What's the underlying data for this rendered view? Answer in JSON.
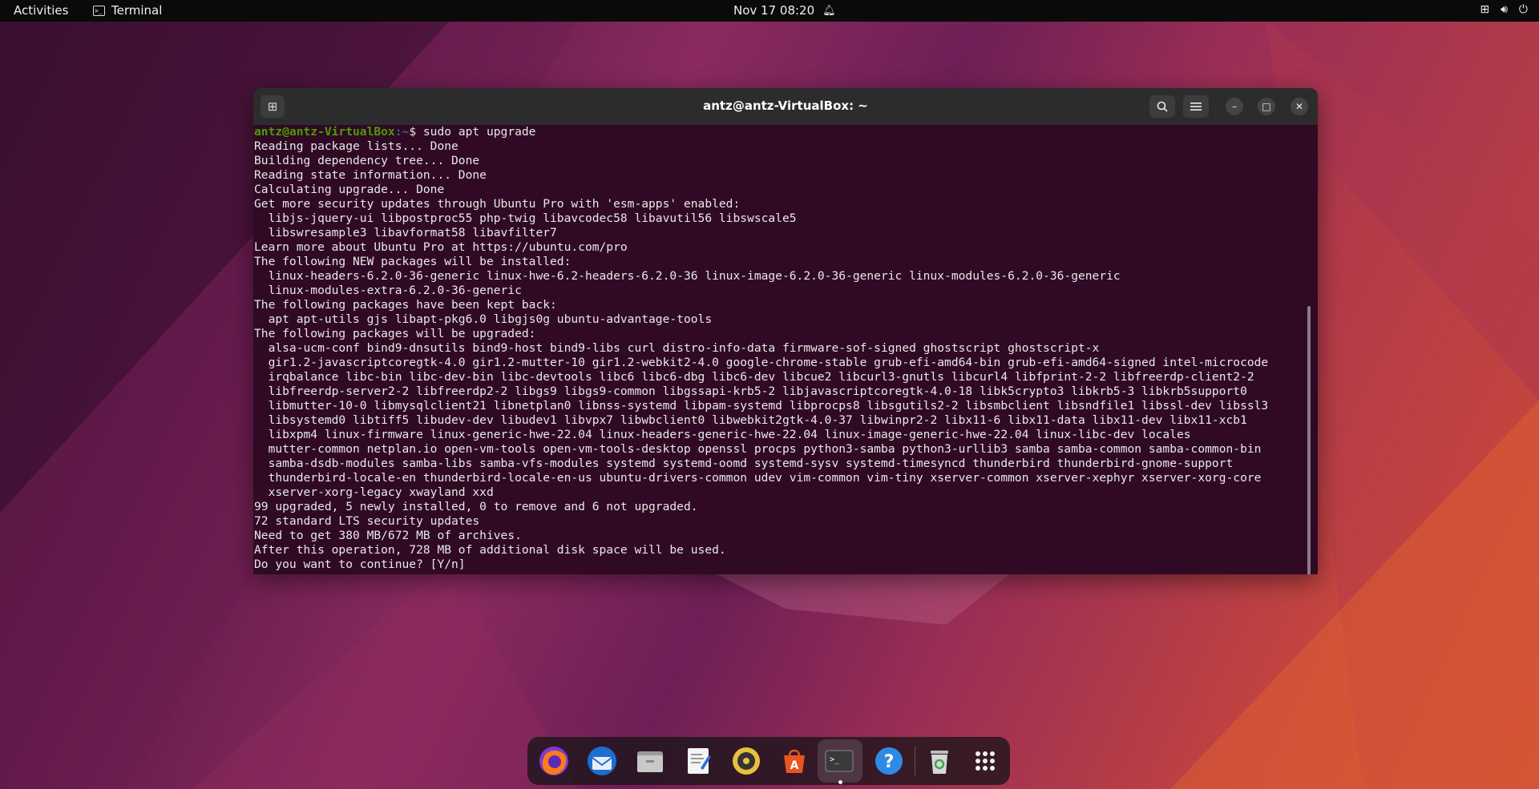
{
  "topbar": {
    "activities": "Activities",
    "app_name": "Terminal",
    "clock": "Nov 17  08:20"
  },
  "window": {
    "title": "antz@antz-VirtualBox: ~"
  },
  "terminal": {
    "prompt_user": "antz@antz-VirtualBox",
    "prompt_path": ":~",
    "prompt_symbol": "$ ",
    "command": "sudo apt upgrade",
    "output": [
      "Reading package lists... Done",
      "Building dependency tree... Done",
      "Reading state information... Done",
      "Calculating upgrade... Done",
      "Get more security updates through Ubuntu Pro with 'esm-apps' enabled:",
      "  libjs-jquery-ui libpostproc55 php-twig libavcodec58 libavutil56 libswscale5",
      "  libswresample3 libavformat58 libavfilter7",
      "Learn more about Ubuntu Pro at https://ubuntu.com/pro",
      "The following NEW packages will be installed:",
      "  linux-headers-6.2.0-36-generic linux-hwe-6.2-headers-6.2.0-36 linux-image-6.2.0-36-generic linux-modules-6.2.0-36-generic",
      "  linux-modules-extra-6.2.0-36-generic",
      "The following packages have been kept back:",
      "  apt apt-utils gjs libapt-pkg6.0 libgjs0g ubuntu-advantage-tools",
      "The following packages will be upgraded:",
      "  alsa-ucm-conf bind9-dnsutils bind9-host bind9-libs curl distro-info-data firmware-sof-signed ghostscript ghostscript-x",
      "  gir1.2-javascriptcoregtk-4.0 gir1.2-mutter-10 gir1.2-webkit2-4.0 google-chrome-stable grub-efi-amd64-bin grub-efi-amd64-signed intel-microcode",
      "  irqbalance libc-bin libc-dev-bin libc-devtools libc6 libc6-dbg libc6-dev libcue2 libcurl3-gnutls libcurl4 libfprint-2-2 libfreerdp-client2-2",
      "  libfreerdp-server2-2 libfreerdp2-2 libgs9 libgs9-common libgssapi-krb5-2 libjavascriptcoregtk-4.0-18 libk5crypto3 libkrb5-3 libkrb5support0",
      "  libmutter-10-0 libmysqlclient21 libnetplan0 libnss-systemd libpam-systemd libprocps8 libsgutils2-2 libsmbclient libsndfile1 libssl-dev libssl3",
      "  libsystemd0 libtiff5 libudev-dev libudev1 libvpx7 libwbclient0 libwebkit2gtk-4.0-37 libwinpr2-2 libx11-6 libx11-data libx11-dev libx11-xcb1",
      "  libxpm4 linux-firmware linux-generic-hwe-22.04 linux-headers-generic-hwe-22.04 linux-image-generic-hwe-22.04 linux-libc-dev locales",
      "  mutter-common netplan.io open-vm-tools open-vm-tools-desktop openssl procps python3-samba python3-urllib3 samba samba-common samba-common-bin",
      "  samba-dsdb-modules samba-libs samba-vfs-modules systemd systemd-oomd systemd-sysv systemd-timesyncd thunderbird thunderbird-gnome-support",
      "  thunderbird-locale-en thunderbird-locale-en-us ubuntu-drivers-common udev vim-common vim-tiny xserver-common xserver-xephyr xserver-xorg-core",
      "  xserver-xorg-legacy xwayland xxd",
      "99 upgraded, 5 newly installed, 0 to remove and 6 not upgraded.",
      "72 standard LTS security updates",
      "Need to get 380 MB/672 MB of archives.",
      "After this operation, 728 MB of additional disk space will be used.",
      "Do you want to continue? [Y/n] "
    ]
  },
  "dock": {
    "items": [
      {
        "name": "firefox",
        "icon": "firefox-icon"
      },
      {
        "name": "thunderbird",
        "icon": "thunderbird-icon"
      },
      {
        "name": "files",
        "icon": "files-icon"
      },
      {
        "name": "text-editor",
        "icon": "text-editor-icon"
      },
      {
        "name": "rhythmbox",
        "icon": "rhythmbox-icon"
      },
      {
        "name": "app-center",
        "icon": "app-center-icon"
      },
      {
        "name": "terminal",
        "icon": "terminal-icon"
      },
      {
        "name": "help",
        "icon": "help-icon"
      },
      {
        "name": "trash",
        "icon": "trash-icon"
      },
      {
        "name": "show-apps",
        "icon": "app-grid-icon"
      }
    ]
  },
  "colors": {
    "terminal_bg": "#300a24",
    "prompt_user": "#4e9a06",
    "prompt_path": "#3465a4",
    "titlebar": "#2c2c2c"
  }
}
